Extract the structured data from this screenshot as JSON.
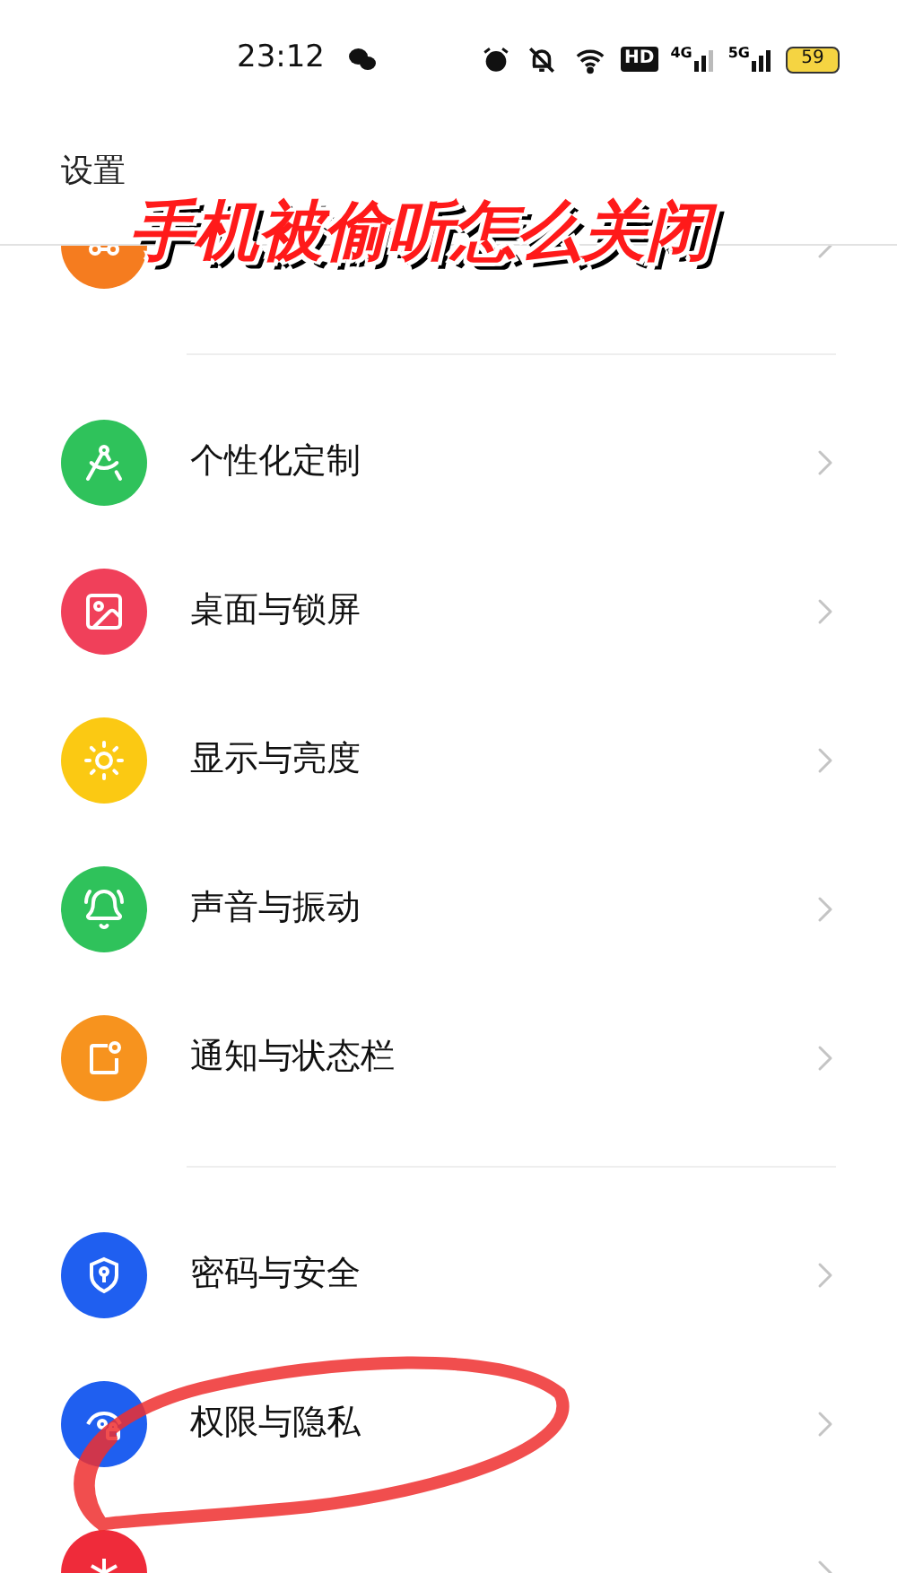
{
  "status_bar": {
    "time": "23:12",
    "hd": "HD",
    "net_1": "4G",
    "net_2": "5G",
    "battery": "59"
  },
  "header": {
    "title": "设置"
  },
  "overlay_title": "手机被偷听怎么关闭",
  "groups": [
    {
      "items": [
        {
          "kind": "apps",
          "color": "#f57c1f"
        }
      ]
    },
    {
      "items": [
        {
          "kind": "personalize",
          "color": "#2fc25b",
          "label": "个性化定制"
        },
        {
          "kind": "wallpaper",
          "color": "#f0405a",
          "label": "桌面与锁屏"
        },
        {
          "kind": "display",
          "color": "#fbc913",
          "label": "显示与亮度"
        },
        {
          "kind": "sound",
          "color": "#2fc25b",
          "label": "声音与振动"
        },
        {
          "kind": "notification",
          "color": "#f7931e",
          "label": "通知与状态栏"
        }
      ]
    },
    {
      "items": [
        {
          "kind": "security",
          "color": "#1f5ff0",
          "label": "密码与安全"
        },
        {
          "kind": "privacy",
          "color": "#1f5ff0",
          "label": "权限与隐私"
        },
        {
          "kind": "emergency",
          "color": "#ef2b3a"
        }
      ]
    }
  ],
  "annotation": {
    "kind": "ellipse"
  }
}
